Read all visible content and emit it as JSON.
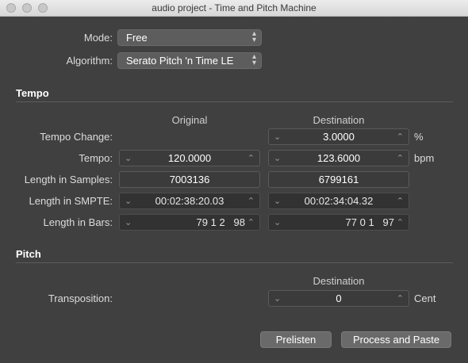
{
  "window": {
    "title": "audio project - Time and Pitch Machine"
  },
  "mode": {
    "label": "Mode:",
    "value": "Free"
  },
  "algorithm": {
    "label": "Algorithm:",
    "value": "Serato Pitch 'n Time LE"
  },
  "tempo_section": {
    "title": "Tempo",
    "col_original": "Original",
    "col_destination": "Destination",
    "rows": [
      {
        "label": "Tempo Change:",
        "original": "",
        "destination": "3.0000",
        "unit": "%"
      },
      {
        "label": "Tempo:",
        "original": "120.0000",
        "destination": "123.6000",
        "unit": "bpm"
      },
      {
        "label": "Length in Samples:",
        "original": "7003136",
        "destination": "6799161",
        "unit": ""
      },
      {
        "label": "Length in SMPTE:",
        "original": "00:02:38:20.03",
        "destination": "00:02:34:04.32",
        "unit": ""
      },
      {
        "label": "Length in Bars:",
        "original": "79 1 2   98",
        "destination": "77 0 1   97",
        "unit": ""
      }
    ]
  },
  "pitch_section": {
    "title": "Pitch",
    "col_destination": "Destination",
    "transposition": {
      "label": "Transposition:",
      "value": "0",
      "unit": "Cent"
    }
  },
  "buttons": {
    "prelisten": "Prelisten",
    "process": "Process and Paste"
  },
  "icons": {
    "stepper_down": "chevron-down-icon",
    "stepper_up": "chevron-up-icon",
    "popup": "updown-chevron-icon"
  }
}
